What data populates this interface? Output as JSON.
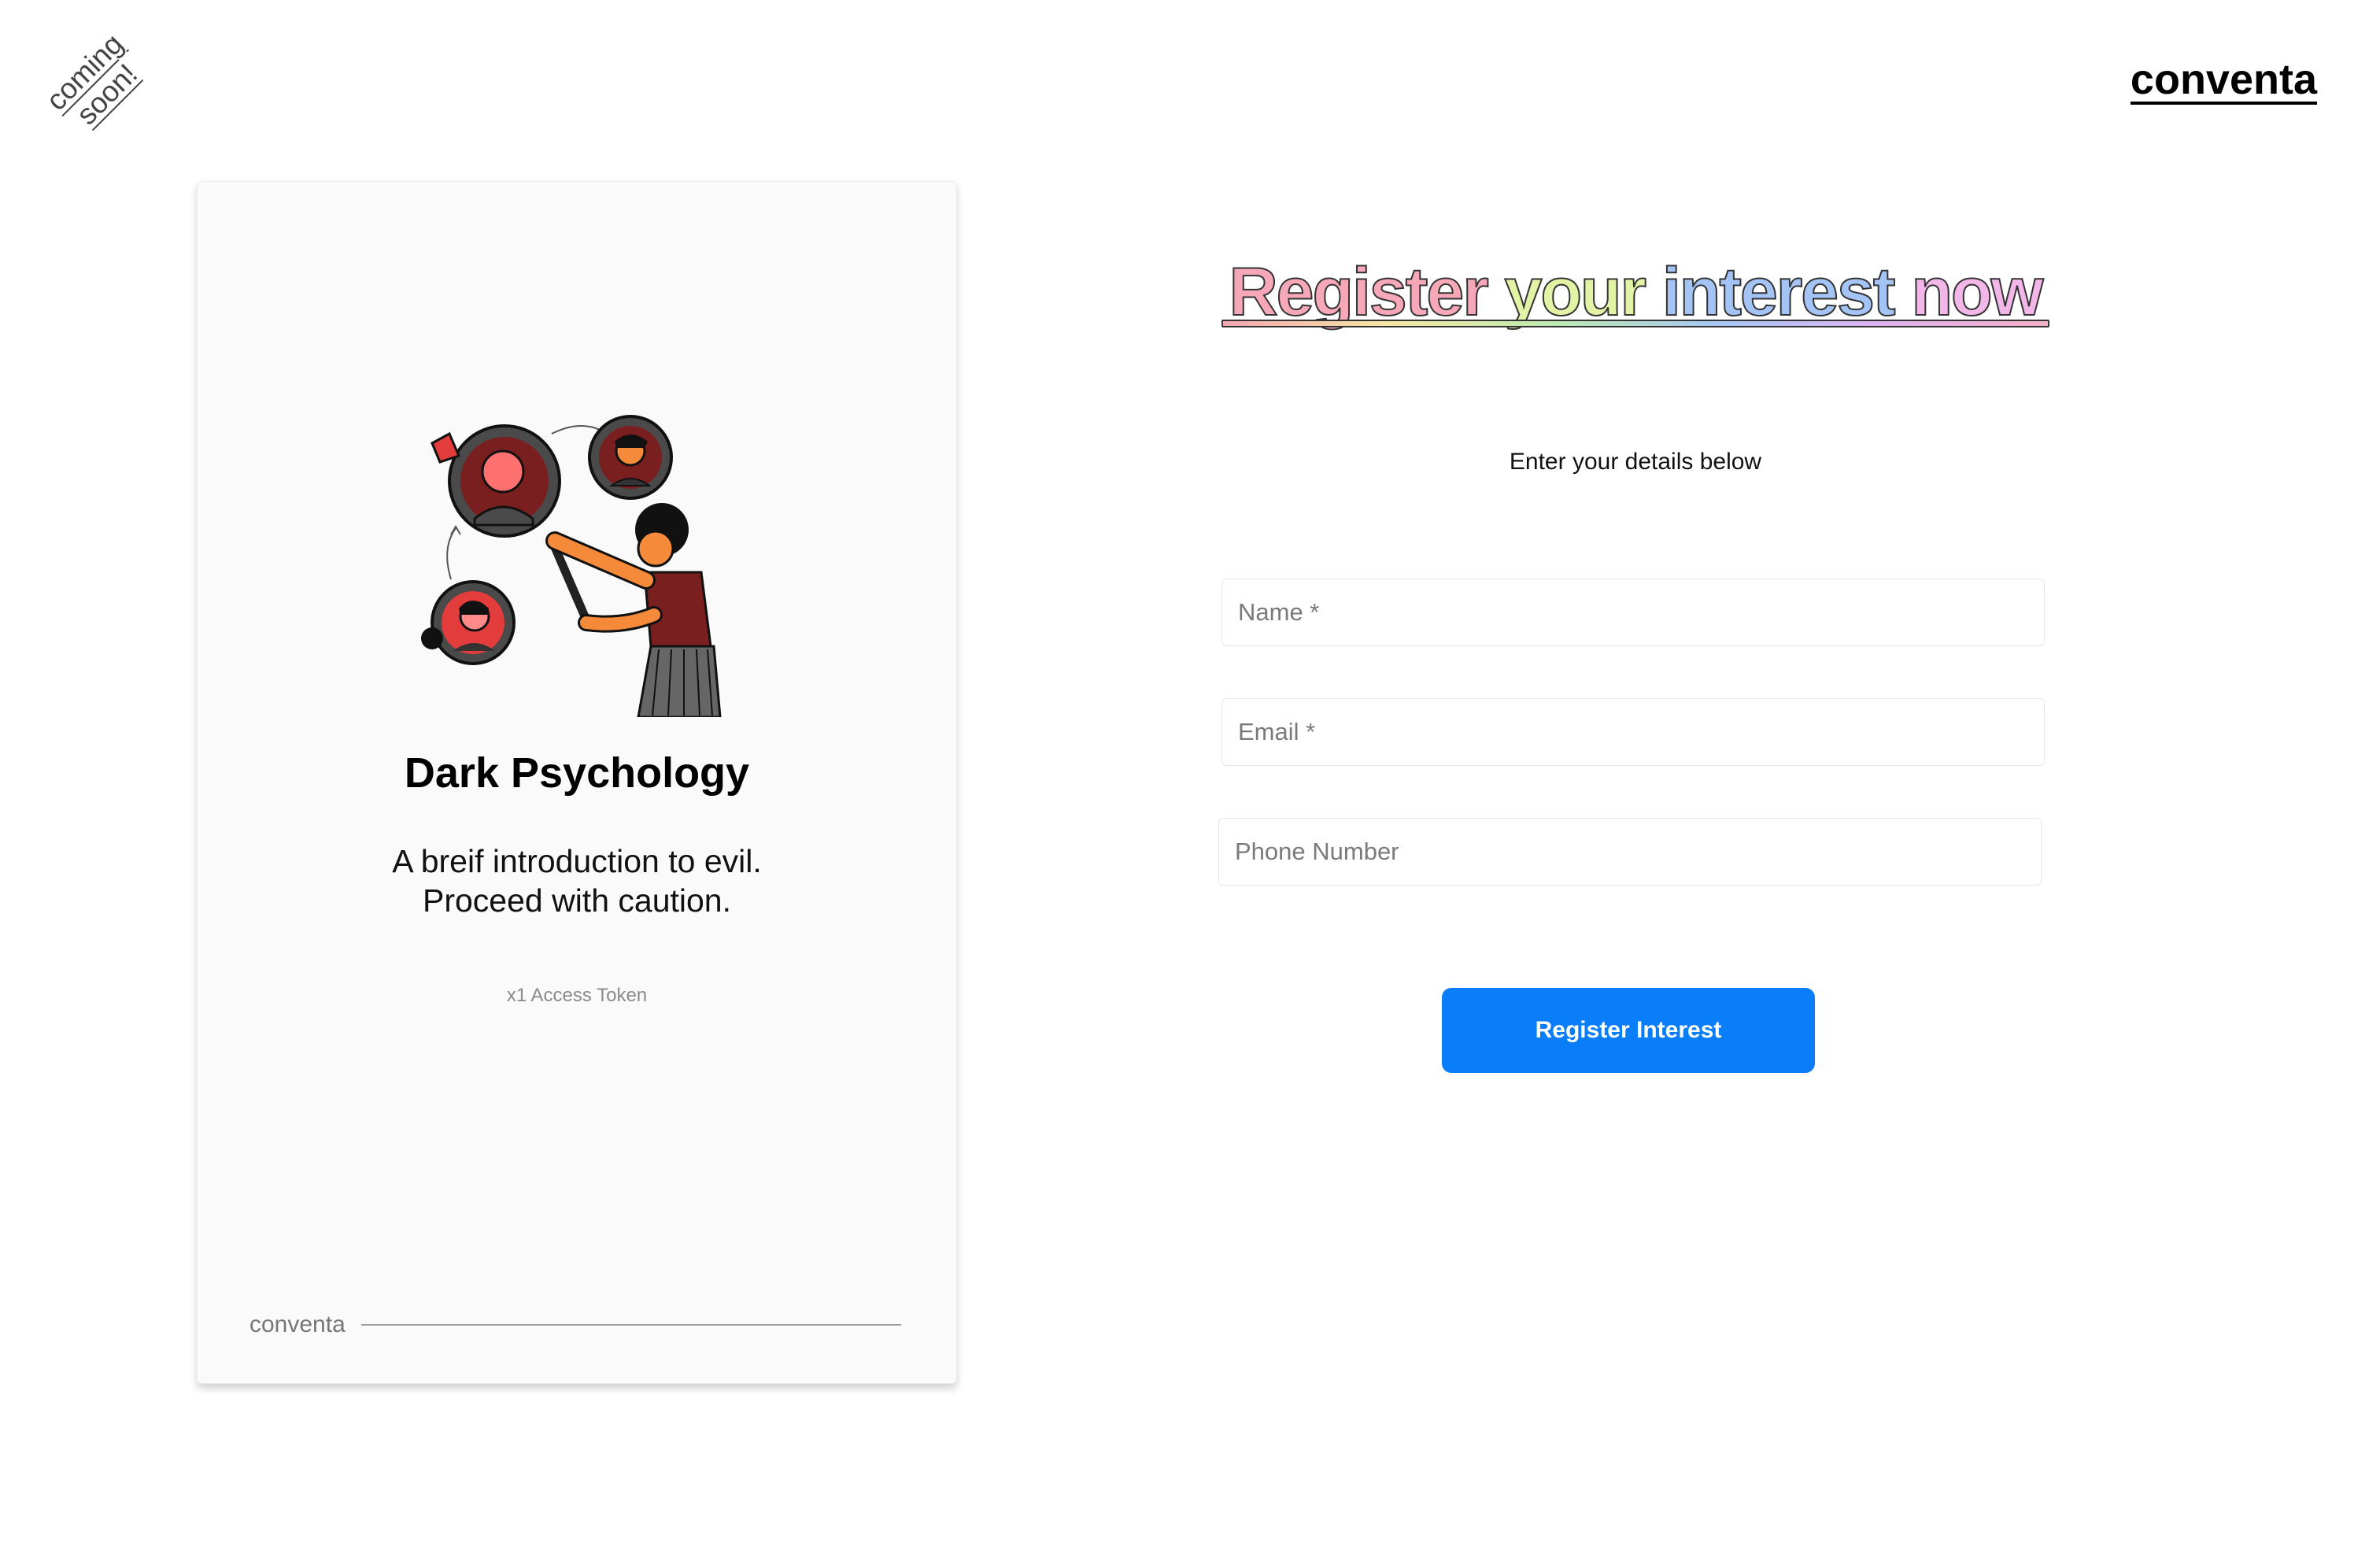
{
  "badge": {
    "line1": "coming",
    "line2": "soon!"
  },
  "header": {
    "brand": "conventa"
  },
  "card": {
    "title": "Dark Psychology",
    "description_line1": "A breif introduction to evil.",
    "description_line2": "Proceed with caution.",
    "token": "x1 Access Token",
    "footer_brand": "conventa",
    "illustration_icon": "person-magnifying-glass-illustration"
  },
  "form": {
    "headline_words": [
      "Register",
      "your",
      "interest",
      "now"
    ],
    "subtitle": "Enter your details below",
    "name_placeholder": "Name *",
    "email_placeholder": "Email *",
    "phone_placeholder": "Phone Number",
    "submit_label": "Register Interest"
  },
  "colors": {
    "button": "#0a7ef8",
    "card_bg": "#fafafa",
    "accent_red": "#e23c3c",
    "accent_orange": "#f58a3b"
  }
}
